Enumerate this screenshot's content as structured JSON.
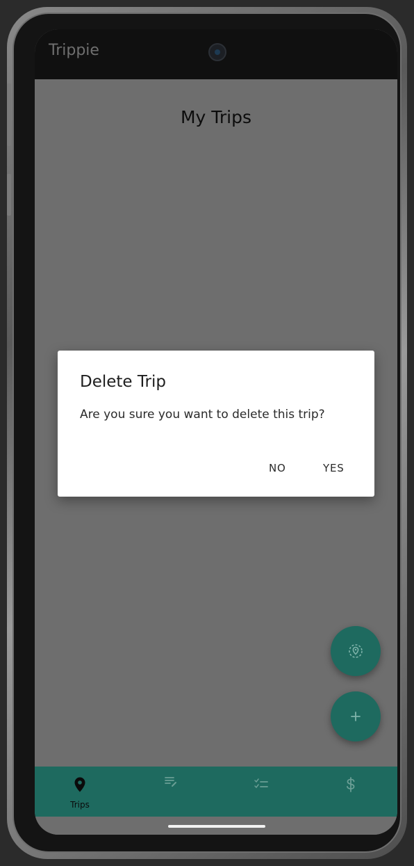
{
  "app": {
    "title": "Trippie"
  },
  "page": {
    "title": "My Trips"
  },
  "dialog": {
    "title": "Delete Trip",
    "message": "Are you sure you want to delete this trip?",
    "no_label": "NO",
    "yes_label": "YES"
  },
  "fabs": [
    {
      "icon": "location-target-icon"
    },
    {
      "icon": "plus-icon"
    }
  ],
  "bottom_nav": {
    "items": [
      {
        "label": "Trips",
        "icon": "location-pin-icon",
        "active": true
      },
      {
        "label": "",
        "icon": "notes-edit-icon",
        "active": false
      },
      {
        "label": "",
        "icon": "checklist-icon",
        "active": false
      },
      {
        "label": "",
        "icon": "dollar-icon",
        "active": false
      }
    ]
  },
  "colors": {
    "accent": "#1e6a5f",
    "scrim": "#6e6e6e",
    "dialog_bg": "#ffffff"
  }
}
